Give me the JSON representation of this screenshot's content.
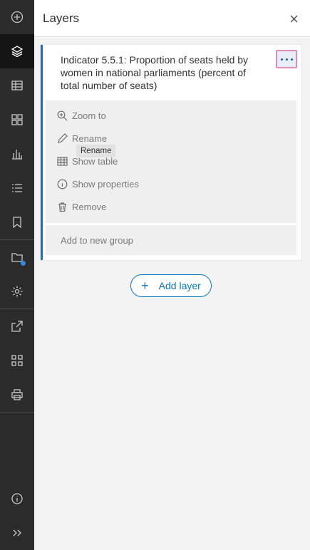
{
  "rail": {
    "items": [
      {
        "icon": "add-circle-icon"
      },
      {
        "icon": "layers-icon",
        "active": true
      },
      {
        "icon": "table-icon"
      },
      {
        "icon": "basemap-gallery-icon"
      },
      {
        "icon": "charts-icon"
      },
      {
        "icon": "legend-icon"
      },
      {
        "icon": "bookmark-icon"
      },
      {
        "icon": "folder-icon",
        "badge_color": "#2b8ce3"
      },
      {
        "icon": "gear-icon"
      },
      {
        "icon": "share-icon"
      },
      {
        "icon": "apps-icon"
      },
      {
        "icon": "print-icon"
      },
      {
        "icon": "info-icon"
      },
      {
        "icon": "expand-icon"
      }
    ]
  },
  "panel": {
    "title": "Layers",
    "close_icon": "close-icon"
  },
  "layer": {
    "title": "Indicator 5.5.1: Proportion of seats held by women in national parliaments (percent of total number of seats)",
    "accent_color": "#0b78be"
  },
  "menu": {
    "items": [
      {
        "label": "Zoom to",
        "icon": "zoom-in-icon"
      },
      {
        "label": "Rename",
        "icon": "pencil-icon"
      },
      {
        "label": "Show table",
        "icon": "table-icon"
      },
      {
        "label": "Show properties",
        "icon": "info-icon"
      },
      {
        "label": "Remove",
        "icon": "trash-icon"
      }
    ],
    "tooltip": "Rename",
    "group_label": "Add to new group"
  },
  "add_layer": {
    "plus": "+",
    "label": "Add layer"
  },
  "colors": {
    "accent": "#0b78be",
    "focus_outline": "#e28aba"
  }
}
